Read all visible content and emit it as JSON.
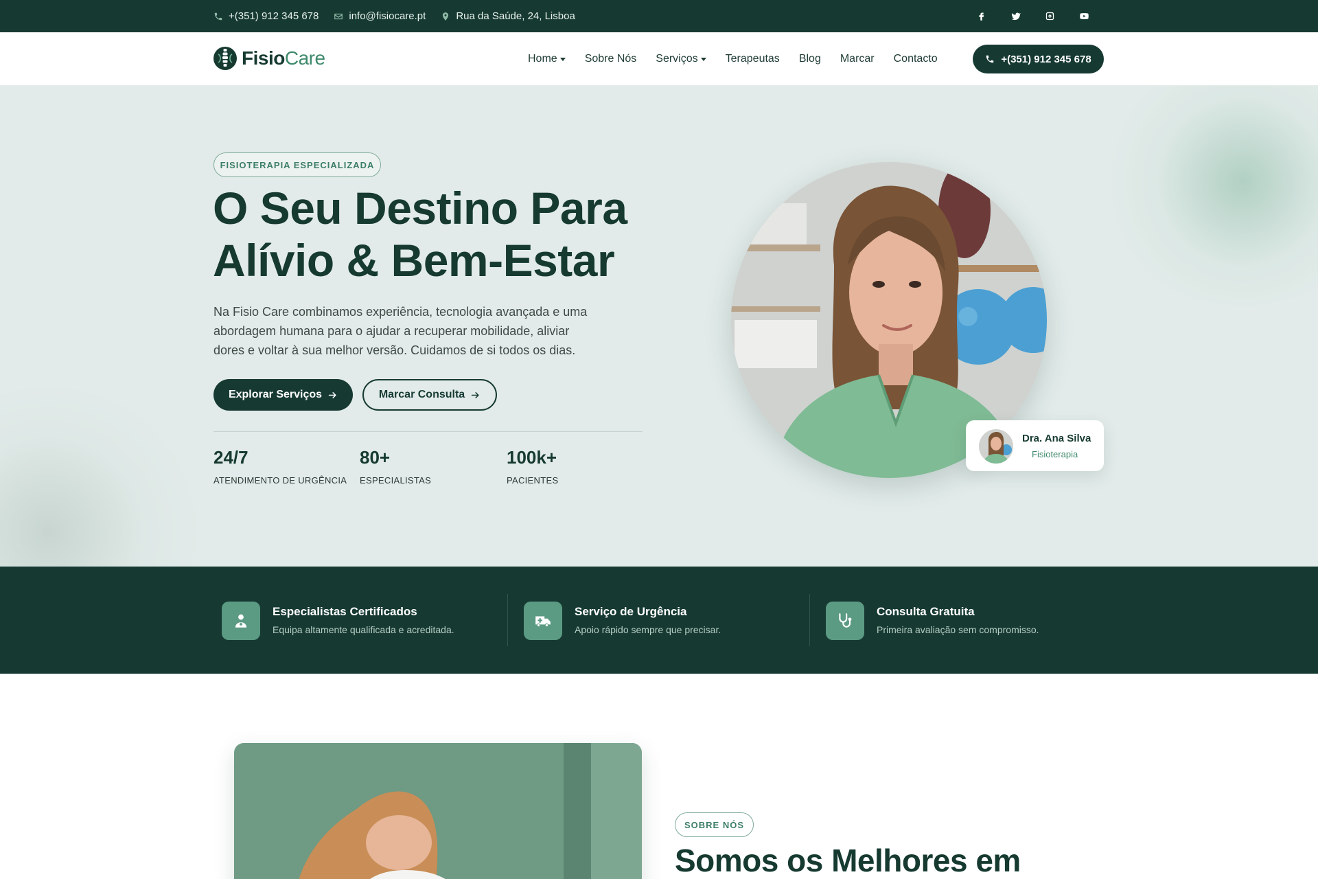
{
  "topbar": {
    "phone": "+(351) 912 345 678",
    "email": "info@fisiocare.pt",
    "address": "Rua da Saúde, 24, Lisboa",
    "social": [
      "facebook-icon",
      "twitter-icon",
      "instagram-icon",
      "youtube-icon"
    ]
  },
  "brand": {
    "name_bold": "Fisio",
    "name_light": "Care"
  },
  "nav": {
    "items": [
      {
        "label": "Home",
        "dropdown": true
      },
      {
        "label": "Sobre Nós",
        "dropdown": false
      },
      {
        "label": "Serviços",
        "dropdown": true
      },
      {
        "label": "Terapeutas",
        "dropdown": false
      },
      {
        "label": "Blog",
        "dropdown": false
      },
      {
        "label": "Marcar",
        "dropdown": false
      },
      {
        "label": "Contacto",
        "dropdown": false
      }
    ],
    "cta": "+(351) 912 345 678"
  },
  "hero": {
    "tag": "FISIOTERAPIA ESPECIALIZADA",
    "title_line1": "O Seu Destino Para",
    "title_line2": "Alívio & Bem-Estar",
    "lead": "Na Fisio Care combinamos experiência, tecnologia avançada e uma abordagem humana para o ajudar a recuperar mobilidade, aliviar dores e voltar à sua melhor versão. Cuidamos de si todos os dias.",
    "primary_button": "Explorar Serviços",
    "secondary_button": "Marcar Consulta",
    "stats": [
      {
        "value": "24/7",
        "label": "ATENDIMENTO DE URGÊNCIA"
      },
      {
        "value": "80+",
        "label": "ESPECIALISTAS"
      },
      {
        "value": "100k+",
        "label": "PACIENTES"
      }
    ],
    "doctor": {
      "name": "Dra. Ana Silva",
      "specialty": "Fisioterapia"
    }
  },
  "features": [
    {
      "title": "Especialistas Certificados",
      "desc": "Equipa altamente qualificada e acreditada.",
      "icon": "doctor-icon"
    },
    {
      "title": "Serviço de Urgência",
      "desc": "Apoio rápido sempre que precisar.",
      "icon": "ambulance-icon"
    },
    {
      "title": "Consulta Gratuita",
      "desc": "Primeira avaliação sem compromisso.",
      "icon": "stethoscope-icon"
    }
  ],
  "about": {
    "tag": "SOBRE NÓS",
    "title": "Somos os Melhores em"
  },
  "colors": {
    "primary": "#163a32",
    "accent": "#3f8a6c",
    "hero_bg": "#e2ebe9",
    "icon_tile": "#5b9a83"
  }
}
